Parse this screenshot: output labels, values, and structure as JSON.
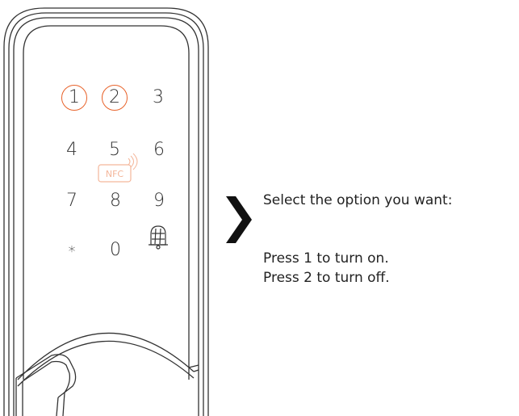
{
  "lock": {
    "keypad": [
      {
        "label": "1",
        "highlighted": true
      },
      {
        "label": "2",
        "highlighted": true
      },
      {
        "label": "3",
        "highlighted": false
      },
      {
        "label": "4",
        "highlighted": false
      },
      {
        "label": "5",
        "highlighted": false
      },
      {
        "label": "6",
        "highlighted": false
      },
      {
        "label": "7",
        "highlighted": false
      },
      {
        "label": "8",
        "highlighted": false
      },
      {
        "label": "9",
        "highlighted": false
      },
      {
        "label": "*",
        "highlighted": false
      },
      {
        "label": "0",
        "highlighted": false
      }
    ],
    "nfc_label": "NFC",
    "highlight_color": "#e8632b",
    "bell_icon": "bell-hash-icon"
  },
  "instructions": {
    "prompt": "Select the option you want:",
    "option_on": "Press 1 to turn on.",
    "option_off": "Press 2 to turn off."
  },
  "arrow_icon": "chevron-right-icon"
}
